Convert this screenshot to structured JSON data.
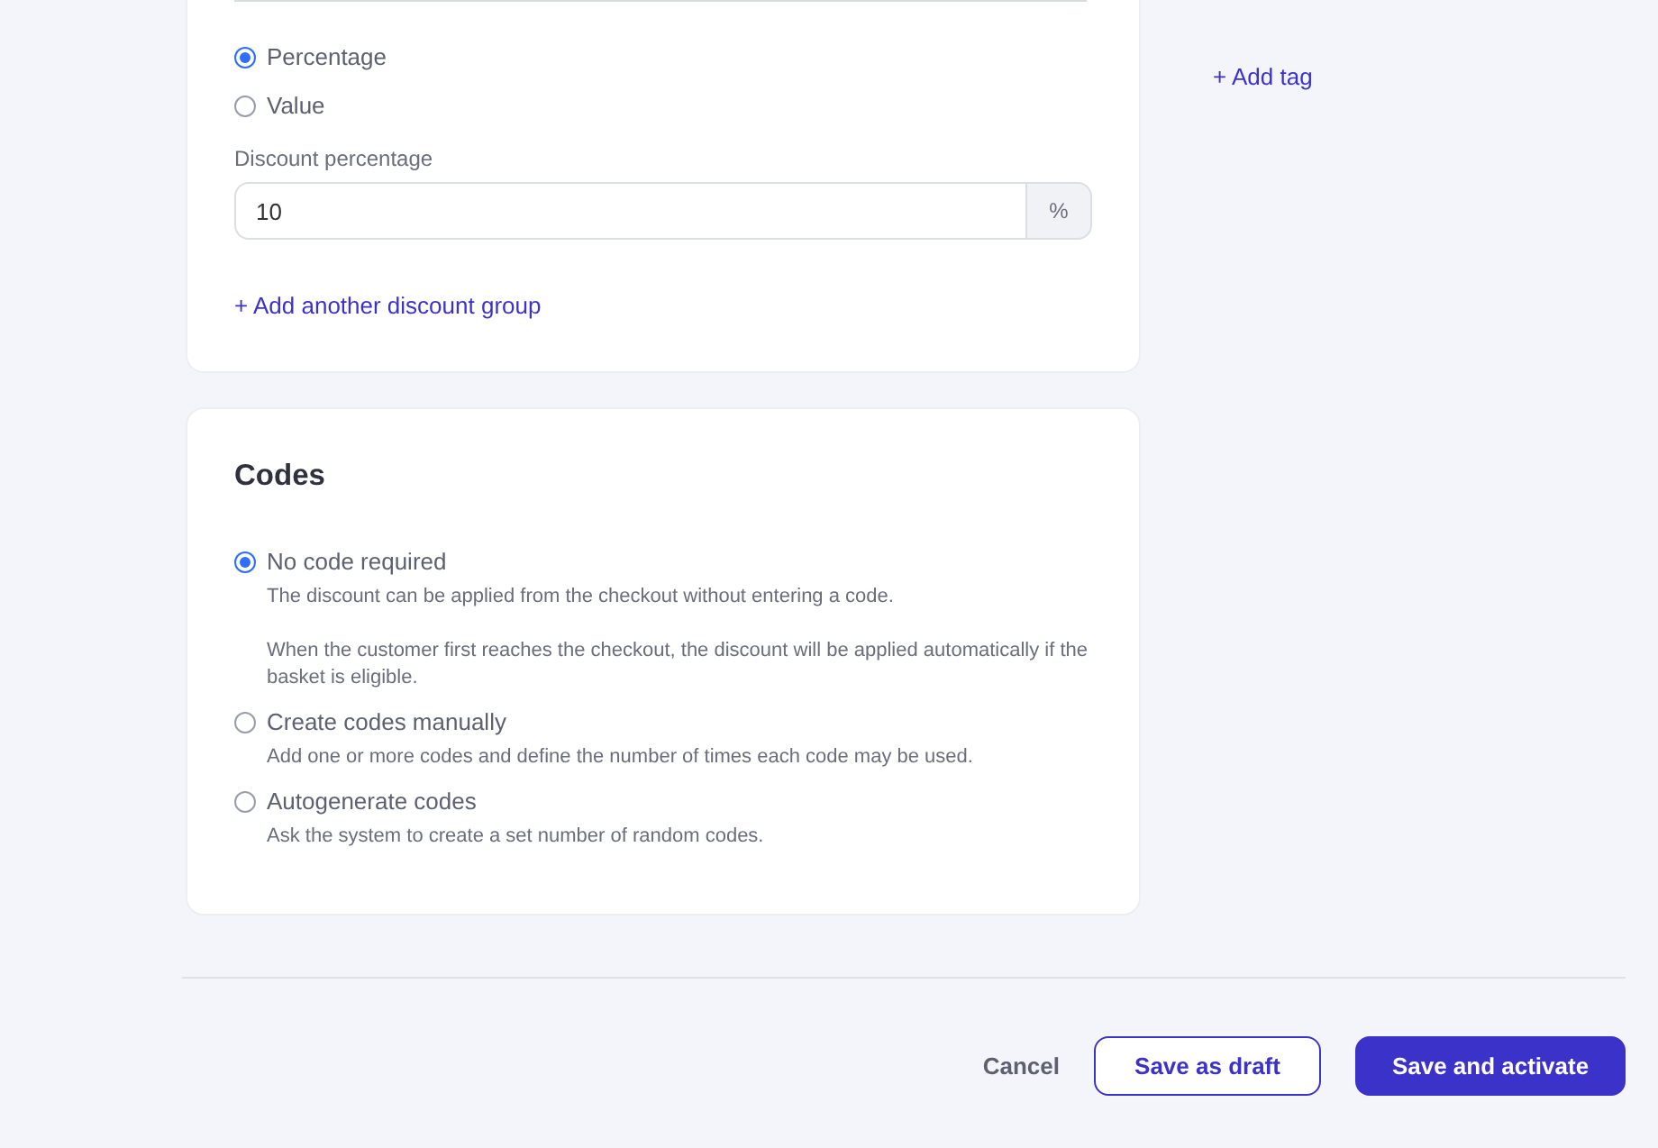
{
  "discount_type": {
    "options": [
      {
        "label": "Percentage",
        "selected": true
      },
      {
        "label": "Value",
        "selected": false
      }
    ]
  },
  "discount_percentage": {
    "label": "Discount percentage",
    "value": "10",
    "suffix": "%"
  },
  "add_group_link": "+ Add another discount group",
  "tags": {
    "add_link": "+ Add tag"
  },
  "codes": {
    "title": "Codes",
    "options": [
      {
        "label": "No code required",
        "selected": true,
        "description": [
          "The discount can be applied from the checkout without entering a code.",
          "When the customer first reaches the checkout, the discount will be applied automatically if the basket is eligible."
        ]
      },
      {
        "label": "Create codes manually",
        "selected": false,
        "description": [
          "Add one or more codes and define the number of times each code may be used."
        ]
      },
      {
        "label": "Autogenerate codes",
        "selected": false,
        "description": [
          "Ask the system to create a set number of random codes."
        ]
      }
    ]
  },
  "footer": {
    "cancel": "Cancel",
    "save_draft": "Save as draft",
    "save_activate": "Save and activate"
  }
}
